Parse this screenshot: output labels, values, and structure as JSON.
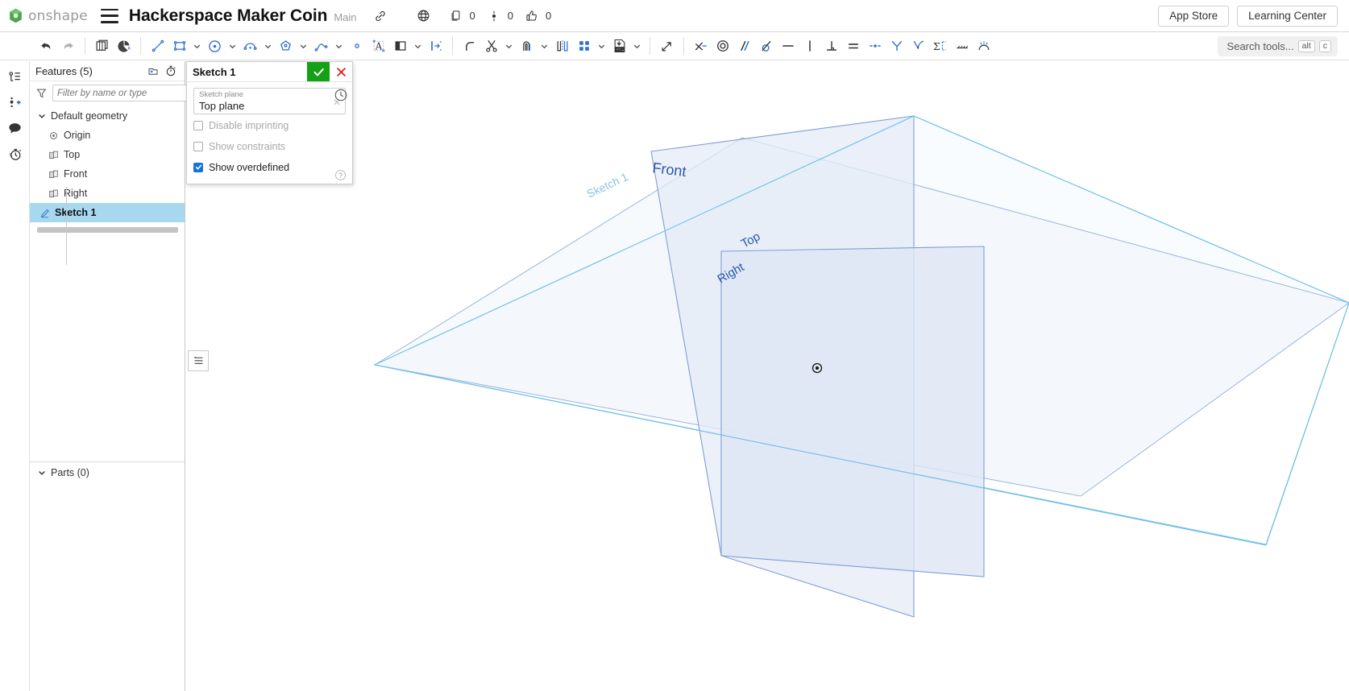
{
  "app": {
    "brand": "onshape",
    "brand_color": "#3aa03a",
    "logo_icon": "onshape-logo-icon",
    "menu_icon": "hamburger-menu-icon"
  },
  "header": {
    "document_title": "Hackerspace Maker Coin",
    "branch": "Main",
    "link_icon": "link-icon",
    "globe_icon": "globe-public-icon",
    "stats": [
      {
        "icon": "copies-icon",
        "name": "copies-count",
        "value": "0"
      },
      {
        "icon": "versions-icon",
        "name": "versions-count",
        "value": "0"
      },
      {
        "icon": "thumbs-up-icon",
        "name": "likes-count",
        "value": "0"
      }
    ],
    "buttons": [
      {
        "label": "App Store",
        "name": "app-store-button"
      },
      {
        "label": "Learning Center",
        "name": "learning-center-button"
      }
    ]
  },
  "toolbar": {
    "search": {
      "label": "Search tools...",
      "shortcut_modifier": "alt",
      "shortcut_key": "c"
    },
    "items": [
      {
        "name": "undo-button",
        "icon": "undo-arrow-icon",
        "caret": false
      },
      {
        "name": "redo-button",
        "icon": "redo-arrow-icon",
        "caret": false
      },
      {
        "name": "divider-1",
        "icon": "divider",
        "caret": false
      },
      {
        "name": "copy-sketch-button",
        "icon": "copy-layers-icon",
        "caret": false
      },
      {
        "name": "sketch-appearance-button",
        "icon": "pie-color-icon",
        "caret": false
      },
      {
        "name": "divider-2",
        "icon": "divider",
        "caret": false
      },
      {
        "name": "line-tool",
        "icon": "line-icon",
        "caret": false
      },
      {
        "name": "rectangle-tool",
        "icon": "rectangle-icon",
        "caret": true
      },
      {
        "name": "circle-tool",
        "icon": "circle-icon",
        "caret": true
      },
      {
        "name": "arc-tool",
        "icon": "arc-icon",
        "caret": true
      },
      {
        "name": "polygon-tool",
        "icon": "polygon-icon",
        "caret": true
      },
      {
        "name": "spline-tool",
        "icon": "spline-icon",
        "caret": true
      },
      {
        "name": "point-tool",
        "icon": "point-icon",
        "caret": false
      },
      {
        "name": "text-tool",
        "icon": "sketch-text-icon",
        "caret": false
      },
      {
        "name": "use-projection-tool",
        "icon": "use-project-icon",
        "caret": true
      },
      {
        "name": "dimension-tool",
        "icon": "dimension-icon",
        "caret": false
      },
      {
        "name": "divider-3",
        "icon": "divider",
        "caret": false
      },
      {
        "name": "fillet-tool",
        "icon": "sketch-fillet-icon",
        "caret": false
      },
      {
        "name": "trim-tool",
        "icon": "trim-scissors-icon",
        "caret": true
      },
      {
        "name": "offset-tool",
        "icon": "offset-icon",
        "caret": true
      },
      {
        "name": "mirror-tool",
        "icon": "mirror-icon",
        "caret": false
      },
      {
        "name": "pattern-tool",
        "icon": "linear-pattern-icon",
        "caret": true
      },
      {
        "name": "export-dxf-tool",
        "icon": "dxf-export-icon",
        "caret": true
      },
      {
        "name": "divider-4",
        "icon": "divider",
        "caret": false
      },
      {
        "name": "transform-tool",
        "icon": "transform-arrow-icon",
        "caret": false
      },
      {
        "name": "divider-5",
        "icon": "divider",
        "caret": false
      },
      {
        "name": "coincident-constraint",
        "icon": "coincident-icon",
        "caret": false
      },
      {
        "name": "concentric-constraint",
        "icon": "concentric-icon",
        "caret": false
      },
      {
        "name": "parallel-constraint",
        "icon": "parallel-icon",
        "caret": false
      },
      {
        "name": "tangent-constraint",
        "icon": "tangent-icon",
        "caret": false
      },
      {
        "name": "horizontal-constraint",
        "icon": "horizontal-icon",
        "caret": false
      },
      {
        "name": "vertical-constraint",
        "icon": "vertical-icon",
        "caret": false
      },
      {
        "name": "perpendicular-constraint",
        "icon": "perpendicular-icon",
        "caret": false
      },
      {
        "name": "equal-constraint",
        "icon": "equal-icon",
        "caret": false
      },
      {
        "name": "midpoint-constraint",
        "icon": "midpoint-icon",
        "caret": false
      },
      {
        "name": "symmetric-constraint",
        "icon": "symmetric-icon",
        "caret": false
      },
      {
        "name": "curvature-constraint",
        "icon": "curvature-icon",
        "caret": false
      },
      {
        "name": "normal-constraint",
        "icon": "normal-icon",
        "caret": false
      },
      {
        "name": "construction-toggle",
        "icon": "construction-icon",
        "caret": false
      },
      {
        "name": "show-constraints-toggle",
        "icon": "constraints-fan-icon",
        "caret": false
      }
    ]
  },
  "rail": [
    {
      "name": "feature-list-icon",
      "title": "Feature list"
    },
    {
      "name": "add-feature-icon",
      "title": "Add feature"
    },
    {
      "name": "comments-icon",
      "title": "Comments"
    },
    {
      "name": "history-icon",
      "title": "History"
    }
  ],
  "panel": {
    "features_title": "Features (5)",
    "add_folder_icon": "add-folder-icon",
    "rollback_icon": "stopwatch-icon",
    "filter_icon": "funnel-filter-icon",
    "filter_placeholder": "Filter by name or type",
    "filter_value": "",
    "tree": [
      {
        "label": "Default geometry",
        "icon": "chevron-down-icon",
        "type": "group",
        "name": "tree-default-geometry"
      },
      {
        "label": "Origin",
        "icon": "origin-icon",
        "type": "child",
        "name": "tree-item-origin"
      },
      {
        "label": "Top",
        "icon": "plane-icon",
        "type": "child",
        "name": "tree-item-top"
      },
      {
        "label": "Front",
        "icon": "plane-icon",
        "type": "child",
        "name": "tree-item-front"
      },
      {
        "label": "Right",
        "icon": "plane-icon",
        "type": "child",
        "name": "tree-item-right"
      },
      {
        "label": "Sketch 1",
        "icon": "sketch-pencil-icon",
        "type": "feature",
        "name": "tree-item-sketch-1",
        "selected": true
      }
    ],
    "parts_label": "Parts (0)",
    "parts_chevron": "chevron-down-icon"
  },
  "sketch_dialog": {
    "title": "Sketch 1",
    "accept_icon": "checkmark-icon",
    "accept_color": "#16a016",
    "cancel_icon": "x-close-icon",
    "cancel_color": "#e02020",
    "clock_icon": "history-clock-icon",
    "help_icon": "question-help-icon",
    "plane_field": {
      "label": "Sketch plane",
      "value": "Top plane",
      "clear_icon": "clear-x-icon"
    },
    "options": [
      {
        "label": "Disable imprinting",
        "checked": false,
        "disabled": true,
        "name": "checkbox-disable-imprinting"
      },
      {
        "label": "Show constraints",
        "checked": false,
        "disabled": true,
        "name": "checkbox-show-constraints"
      },
      {
        "label": "Show overdefined",
        "checked": true,
        "disabled": false,
        "name": "checkbox-show-overdefined"
      }
    ]
  },
  "viewport": {
    "list_button_icon": "view-list-icon",
    "origin_marker": "origin-point-marker",
    "plane_labels": [
      {
        "text": "Front",
        "name": "plane-label-front",
        "color": "#2b56a8"
      },
      {
        "text": "Top",
        "name": "plane-label-top",
        "color": "#2b56a8"
      },
      {
        "text": "Right",
        "name": "plane-label-right",
        "color": "#2b56a8"
      },
      {
        "text": "Sketch 1",
        "name": "plane-label-sketch-1",
        "color": "#7fb7d9"
      }
    ],
    "colors": {
      "plane_fill": "#dfe6f4",
      "plane_stroke": "#9ab3dd",
      "sketch_stroke": "#6fc0e8"
    }
  }
}
